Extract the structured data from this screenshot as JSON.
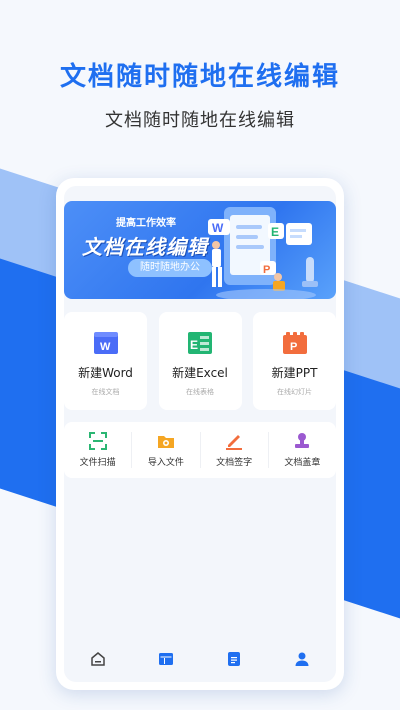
{
  "promo": {
    "headline": "文档随时随地在线编辑",
    "subline": "文档随时随地在线编辑"
  },
  "banner": {
    "small_text": "提高工作效率",
    "big_text": "文档在线编辑",
    "pill_text": "随时随地办公"
  },
  "cards": [
    {
      "title": "新建Word",
      "subtitle": "在线文档",
      "icon": "word-doc-icon",
      "color": "#4a6cf7",
      "letter": "W"
    },
    {
      "title": "新建Excel",
      "subtitle": "在线表格",
      "icon": "excel-sheet-icon",
      "color": "#22b573",
      "letter": "E"
    },
    {
      "title": "新建PPT",
      "subtitle": "在线幻灯片",
      "icon": "ppt-slide-icon",
      "color": "#f26d3d",
      "letter": "P"
    }
  ],
  "tools": [
    {
      "label": "文件扫描",
      "icon": "scan-icon",
      "color": "#2bb673"
    },
    {
      "label": "导入文件",
      "icon": "import-folder-icon",
      "color": "#f5a623"
    },
    {
      "label": "文档签字",
      "icon": "sign-pen-icon",
      "color": "#f26d3d"
    },
    {
      "label": "文档盖章",
      "icon": "stamp-icon",
      "color": "#9b59d0"
    }
  ],
  "tabbar": [
    {
      "icon": "home-icon",
      "color": "#444444"
    },
    {
      "icon": "templates-icon",
      "color": "#1f6ff0"
    },
    {
      "icon": "documents-icon",
      "color": "#1f6ff0"
    },
    {
      "icon": "profile-icon",
      "color": "#1f6ff0"
    }
  ],
  "colors": {
    "brand": "#1f6ff0",
    "background": "#f5f8fd"
  }
}
